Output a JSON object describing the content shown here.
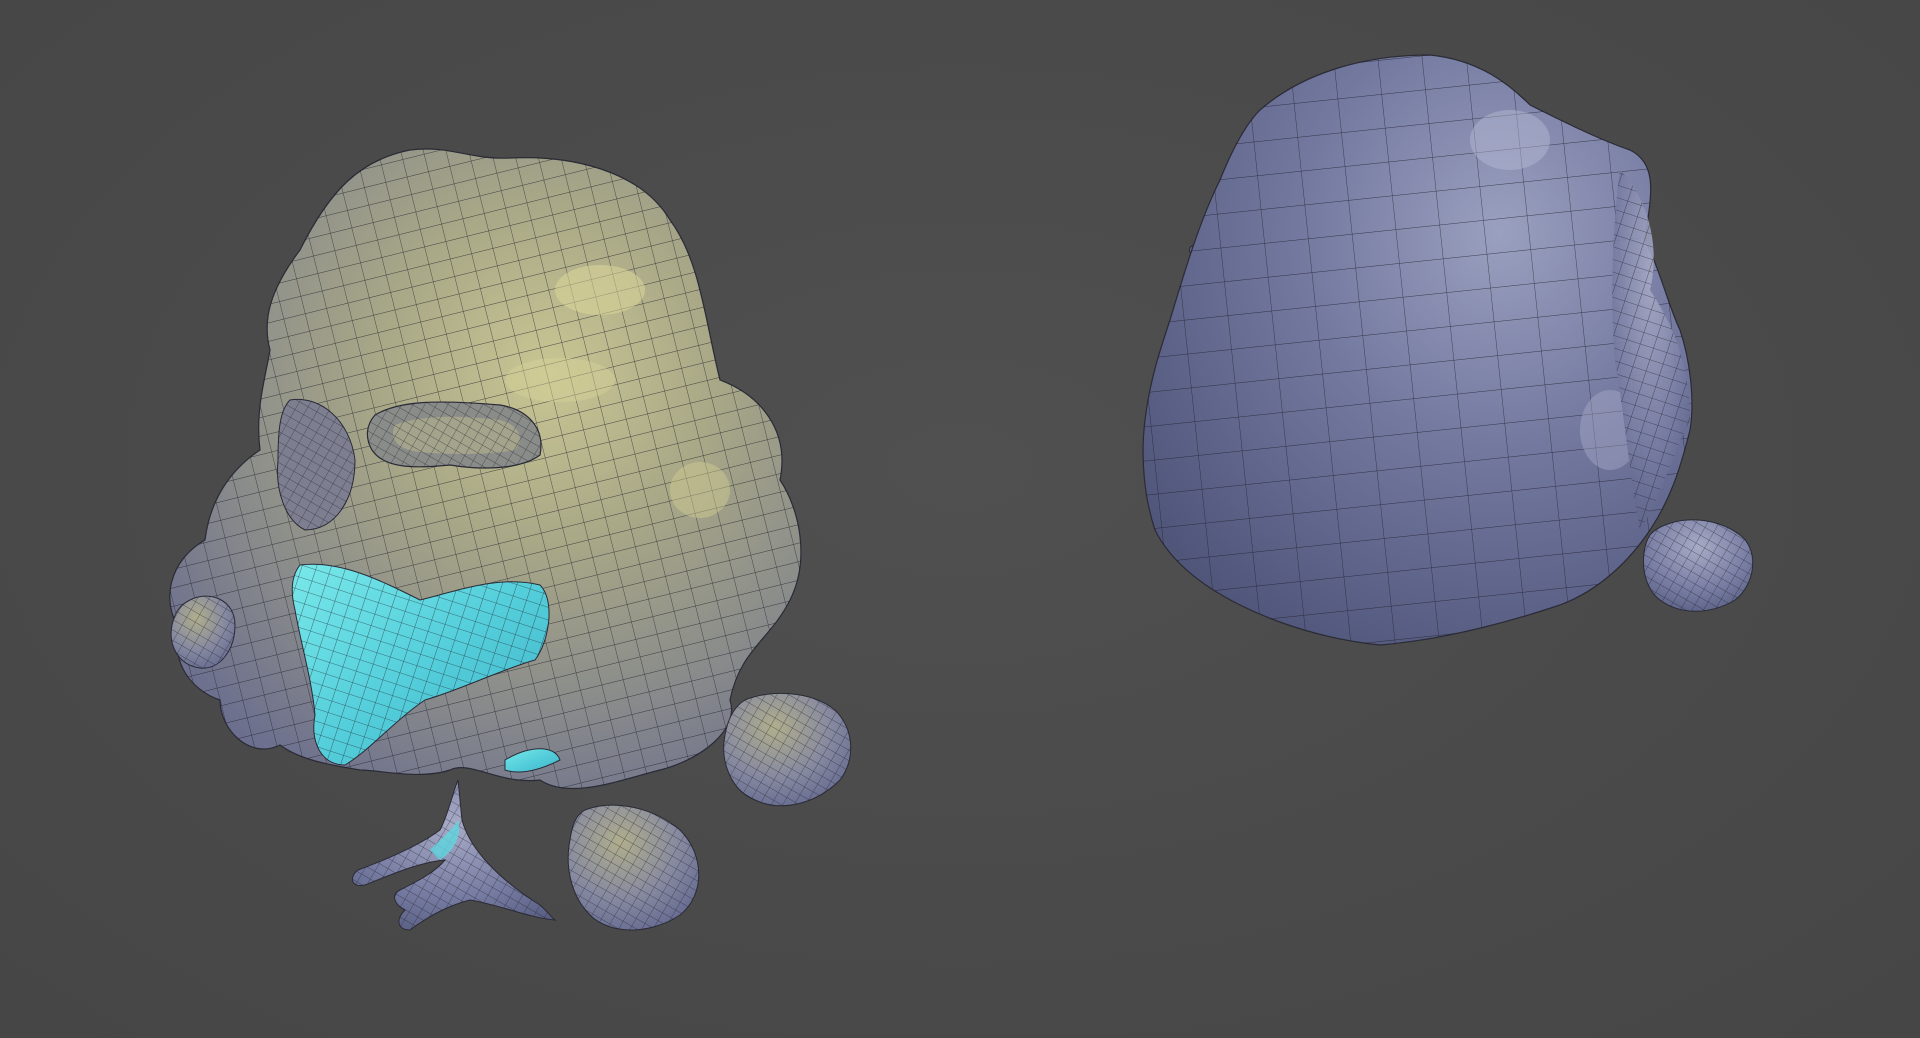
{
  "viewport": {
    "background": "#4a4a4a"
  },
  "objects": [
    {
      "name": "skull-rock-mesh",
      "shading": "wireframe-on-shaded",
      "colors": {
        "surface_light": "#b7b48f",
        "surface_mid": "#8f8f86",
        "surface_shadow": "#6d6f8a",
        "interior_glow": "#5fd6df",
        "wire": "#1d1d28"
      },
      "features": [
        "eye-socket",
        "nose-cavity",
        "mouth-cavity",
        "boulder-right",
        "boulder-front",
        "boulder-left",
        "bone-pile"
      ]
    },
    {
      "name": "rock-back-mesh",
      "shading": "wireframe-on-shaded",
      "colors": {
        "surface_light": "#8d93b4",
        "surface_mid": "#6f759b",
        "surface_shadow": "#545a7a",
        "wire": "#1d1d28"
      },
      "features": [
        "main-dome",
        "side-lump",
        "small-boulder"
      ]
    }
  ]
}
